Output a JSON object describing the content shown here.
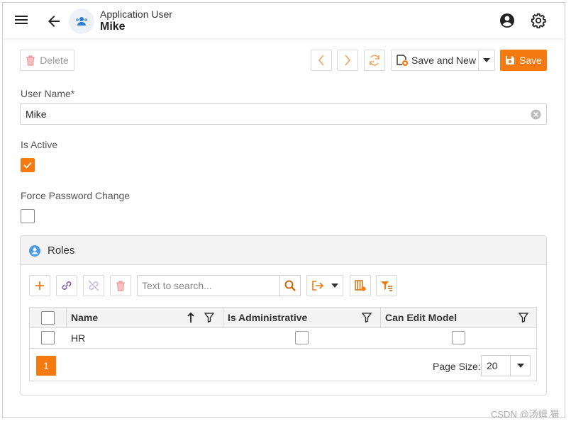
{
  "header": {
    "subtitle": "Application User",
    "title": "Mike"
  },
  "toolbar": {
    "delete_label": "Delete",
    "save_new_label": "Save and New",
    "save_label": "Save"
  },
  "form": {
    "user_name_label": "User Name*",
    "user_name_value": "Mike",
    "is_active_label": "Is Active",
    "is_active_checked": true,
    "force_pwd_label": "Force Password Change",
    "force_pwd_checked": false
  },
  "roles": {
    "title": "Roles",
    "search_placeholder": "Text to search...",
    "columns": [
      "Name",
      "Is Administrative",
      "Can Edit Model"
    ],
    "rows": [
      {
        "name": "HR",
        "is_administrative": false,
        "can_edit_model": false
      }
    ],
    "pager": {
      "current_page": "1",
      "page_size_label": "Page Size:",
      "page_size": "20"
    }
  },
  "watermark": "CSDN @汤姆 猫",
  "colors": {
    "accent": "#f47a0f",
    "border": "#d8d8d8"
  }
}
